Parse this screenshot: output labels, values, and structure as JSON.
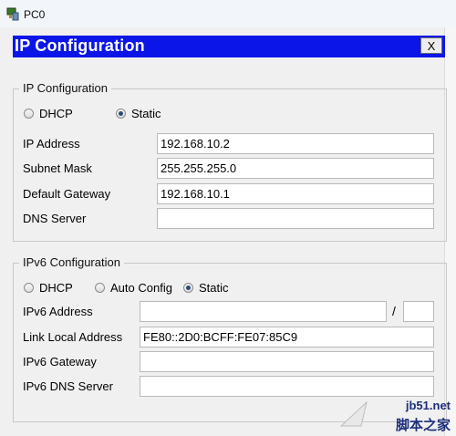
{
  "window": {
    "title": "PC0"
  },
  "dialog": {
    "title": "IP Configuration",
    "close_label": "X"
  },
  "ipv4": {
    "group_title": "IP Configuration",
    "mode_options": [
      "DHCP",
      "Static"
    ],
    "mode_selected": "Static",
    "fields": [
      {
        "label": "IP Address",
        "value": "192.168.10.2"
      },
      {
        "label": "Subnet Mask",
        "value": "255.255.255.0"
      },
      {
        "label": "Default Gateway",
        "value": "192.168.10.1"
      },
      {
        "label": "DNS Server",
        "value": ""
      }
    ]
  },
  "ipv6": {
    "group_title": "IPv6 Configuration",
    "mode_options": [
      "DHCP",
      "Auto Config",
      "Static"
    ],
    "mode_selected": "Static",
    "fields": [
      {
        "label": "IPv6 Address",
        "value": "",
        "prefix": ""
      },
      {
        "label": "Link Local Address",
        "value": "FE80::2D0:BCFF:FE07:85C9"
      },
      {
        "label": "IPv6 Gateway",
        "value": ""
      },
      {
        "label": "IPv6 DNS Server",
        "value": ""
      }
    ],
    "prefix_separator": "/"
  },
  "watermark": {
    "line1": "jb51.net",
    "line2": "脚本之家"
  }
}
